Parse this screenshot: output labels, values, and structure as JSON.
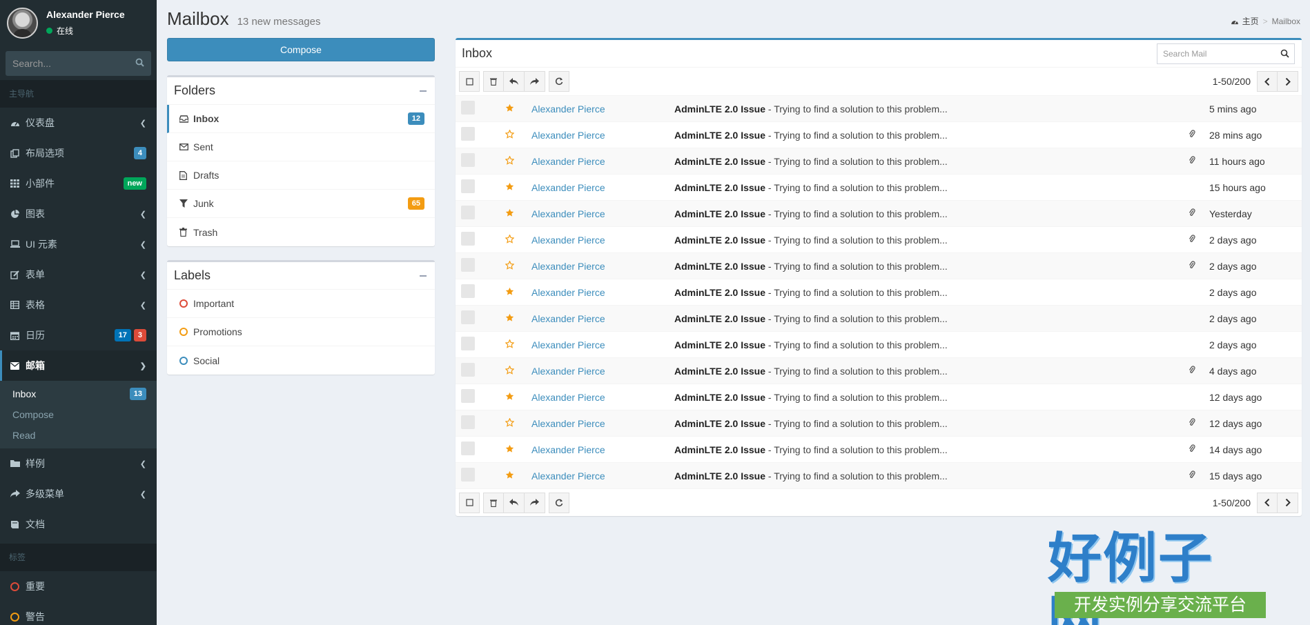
{
  "sidebar": {
    "user_name": "Alexander Pierce",
    "user_status": "在线",
    "search_placeholder": "Search...",
    "main_header": "主导航",
    "nav": [
      {
        "label": "仪表盘",
        "icon": "dashboard-icon"
      },
      {
        "label": "布局选项",
        "icon": "files-icon",
        "badge": "4"
      },
      {
        "label": "小部件",
        "icon": "grid-icon",
        "badge": "new"
      },
      {
        "label": "图表",
        "icon": "pie-chart-icon"
      },
      {
        "label": "UI 元素",
        "icon": "laptop-icon"
      },
      {
        "label": "表单",
        "icon": "edit-icon"
      },
      {
        "label": "表格",
        "icon": "table-icon"
      },
      {
        "label": "日历",
        "icon": "calendar-icon",
        "badges": [
          "17",
          "3"
        ]
      },
      {
        "label": "邮箱",
        "icon": "envelope-icon"
      },
      {
        "label": "样例",
        "icon": "folder-icon"
      },
      {
        "label": "多级菜单",
        "icon": "share-icon"
      },
      {
        "label": "文档",
        "icon": "book-icon"
      }
    ],
    "mailbox_sub": [
      {
        "label": "Inbox",
        "badge": "13"
      },
      {
        "label": "Compose"
      },
      {
        "label": "Read"
      }
    ],
    "labels_header": "标签",
    "labels": [
      {
        "label": "重要",
        "color": "#dd4b39"
      },
      {
        "label": "警告",
        "color": "#f39c12"
      }
    ]
  },
  "page": {
    "title": "Mailbox",
    "subtitle": "13 new messages",
    "breadcrumb_home": "主页",
    "breadcrumb_current": "Mailbox",
    "breadcrumb_sep": ">"
  },
  "compose_label": "Compose",
  "folders": {
    "title": "Folders",
    "items": [
      {
        "label": "Inbox",
        "badge": "12"
      },
      {
        "label": "Sent"
      },
      {
        "label": "Drafts"
      },
      {
        "label": "Junk",
        "badge": "65"
      },
      {
        "label": "Trash"
      }
    ]
  },
  "labels_box": {
    "title": "Labels",
    "items": [
      {
        "label": "Important",
        "color": "#dd4b39"
      },
      {
        "label": "Promotions",
        "color": "#f39c12"
      },
      {
        "label": "Social",
        "color": "#3c8dbc"
      }
    ]
  },
  "inbox": {
    "title": "Inbox",
    "search_placeholder": "Search Mail",
    "pager": "1-50/200",
    "rows": [
      {
        "sender": "Alexander Pierce",
        "subject": "AdminLTE 2.0 Issue",
        "preview": " - Trying to find a solution to this problem...",
        "date": "5 mins ago",
        "starred": true,
        "attach": false
      },
      {
        "sender": "Alexander Pierce",
        "subject": "AdminLTE 2.0 Issue",
        "preview": " - Trying to find a solution to this problem...",
        "date": "28 mins ago",
        "starred": false,
        "attach": true
      },
      {
        "sender": "Alexander Pierce",
        "subject": "AdminLTE 2.0 Issue",
        "preview": " - Trying to find a solution to this problem...",
        "date": "11 hours ago",
        "starred": false,
        "attach": true
      },
      {
        "sender": "Alexander Pierce",
        "subject": "AdminLTE 2.0 Issue",
        "preview": " - Trying to find a solution to this problem...",
        "date": "15 hours ago",
        "starred": true,
        "attach": false
      },
      {
        "sender": "Alexander Pierce",
        "subject": "AdminLTE 2.0 Issue",
        "preview": " - Trying to find a solution to this problem...",
        "date": "Yesterday",
        "starred": true,
        "attach": true
      },
      {
        "sender": "Alexander Pierce",
        "subject": "AdminLTE 2.0 Issue",
        "preview": " - Trying to find a solution to this problem...",
        "date": "2 days ago",
        "starred": false,
        "attach": true
      },
      {
        "sender": "Alexander Pierce",
        "subject": "AdminLTE 2.0 Issue",
        "preview": " - Trying to find a solution to this problem...",
        "date": "2 days ago",
        "starred": false,
        "attach": true
      },
      {
        "sender": "Alexander Pierce",
        "subject": "AdminLTE 2.0 Issue",
        "preview": " - Trying to find a solution to this problem...",
        "date": "2 days ago",
        "starred": true,
        "attach": false
      },
      {
        "sender": "Alexander Pierce",
        "subject": "AdminLTE 2.0 Issue",
        "preview": " - Trying to find a solution to this problem...",
        "date": "2 days ago",
        "starred": true,
        "attach": false
      },
      {
        "sender": "Alexander Pierce",
        "subject": "AdminLTE 2.0 Issue",
        "preview": " - Trying to find a solution to this problem...",
        "date": "2 days ago",
        "starred": false,
        "attach": false
      },
      {
        "sender": "Alexander Pierce",
        "subject": "AdminLTE 2.0 Issue",
        "preview": " - Trying to find a solution to this problem...",
        "date": "4 days ago",
        "starred": false,
        "attach": true
      },
      {
        "sender": "Alexander Pierce",
        "subject": "AdminLTE 2.0 Issue",
        "preview": " - Trying to find a solution to this problem...",
        "date": "12 days ago",
        "starred": true,
        "attach": false
      },
      {
        "sender": "Alexander Pierce",
        "subject": "AdminLTE 2.0 Issue",
        "preview": " - Trying to find a solution to this problem...",
        "date": "12 days ago",
        "starred": false,
        "attach": true
      },
      {
        "sender": "Alexander Pierce",
        "subject": "AdminLTE 2.0 Issue",
        "preview": " - Trying to find a solution to this problem...",
        "date": "14 days ago",
        "starred": true,
        "attach": true
      },
      {
        "sender": "Alexander Pierce",
        "subject": "AdminLTE 2.0 Issue",
        "preview": " - Trying to find a solution to this problem...",
        "date": "15 days ago",
        "starred": true,
        "attach": true
      }
    ]
  },
  "watermark": {
    "title": "好例子网",
    "subtitle": "开发实例分享交流平台"
  },
  "colors": {
    "accent": "#3c8dbc",
    "star": "#f39c12",
    "sidebar_bg": "#222d32"
  }
}
